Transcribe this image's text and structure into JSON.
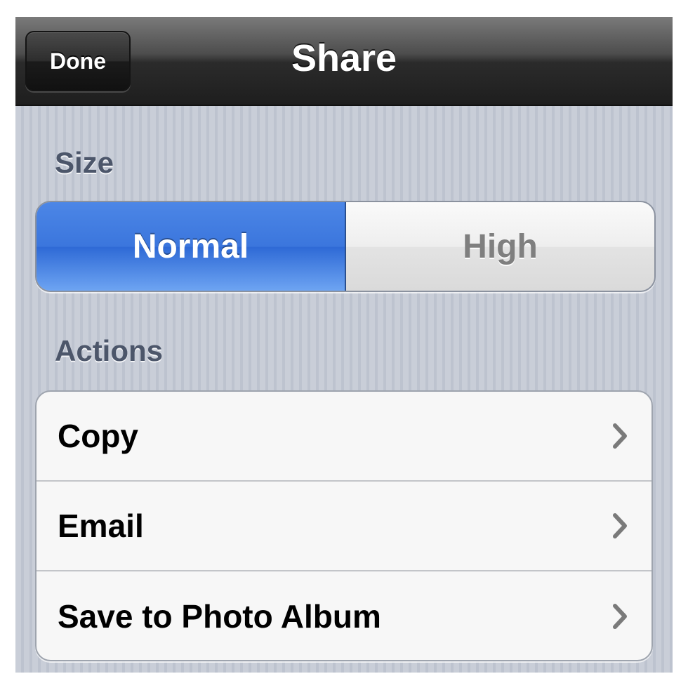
{
  "navbar": {
    "title": "Share",
    "done_label": "Done"
  },
  "size": {
    "label": "Size",
    "options": [
      "Normal",
      "High"
    ],
    "selected": "Normal"
  },
  "actions": {
    "label": "Actions",
    "items": [
      {
        "label": "Copy",
        "icon": "chevron-right-icon"
      },
      {
        "label": "Email",
        "icon": "chevron-right-icon"
      },
      {
        "label": "Save to Photo Album",
        "icon": "chevron-right-icon"
      }
    ]
  },
  "colors": {
    "navbar": "#2b2b2b",
    "selected_segment": "#3b76dd",
    "background": "#c7ccd6",
    "section_label": "#4c566a"
  }
}
